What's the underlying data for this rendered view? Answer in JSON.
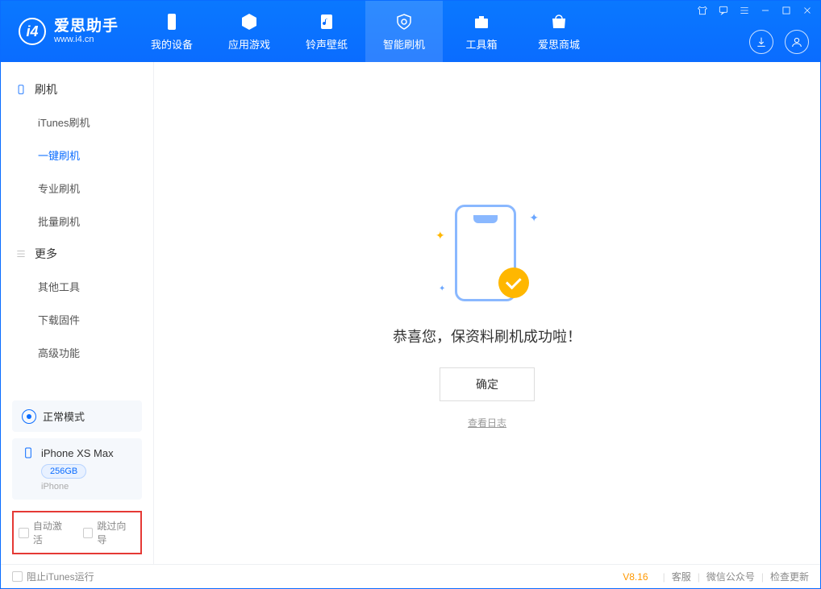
{
  "app": {
    "title": "爱思助手",
    "subtitle": "www.i4.cn"
  },
  "nav": {
    "items": [
      {
        "label": "我的设备"
      },
      {
        "label": "应用游戏"
      },
      {
        "label": "铃声壁纸"
      },
      {
        "label": "智能刷机"
      },
      {
        "label": "工具箱"
      },
      {
        "label": "爱思商城"
      }
    ]
  },
  "sidebar": {
    "group1": {
      "title": "刷机",
      "items": [
        "iTunes刷机",
        "一键刷机",
        "专业刷机",
        "批量刷机"
      ]
    },
    "group2": {
      "title": "更多",
      "items": [
        "其他工具",
        "下载固件",
        "高级功能"
      ]
    },
    "mode": "正常模式",
    "device": {
      "name": "iPhone XS Max",
      "storage": "256GB",
      "type": "iPhone"
    },
    "checks": {
      "auto_activate": "自动激活",
      "skip_guide": "跳过向导"
    }
  },
  "main": {
    "success_msg": "恭喜您，保资料刷机成功啦！",
    "confirm": "确定",
    "view_log": "查看日志"
  },
  "status": {
    "block_itunes": "阻止iTunes运行",
    "version": "V8.16",
    "links": [
      "客服",
      "微信公众号",
      "检查更新"
    ]
  }
}
